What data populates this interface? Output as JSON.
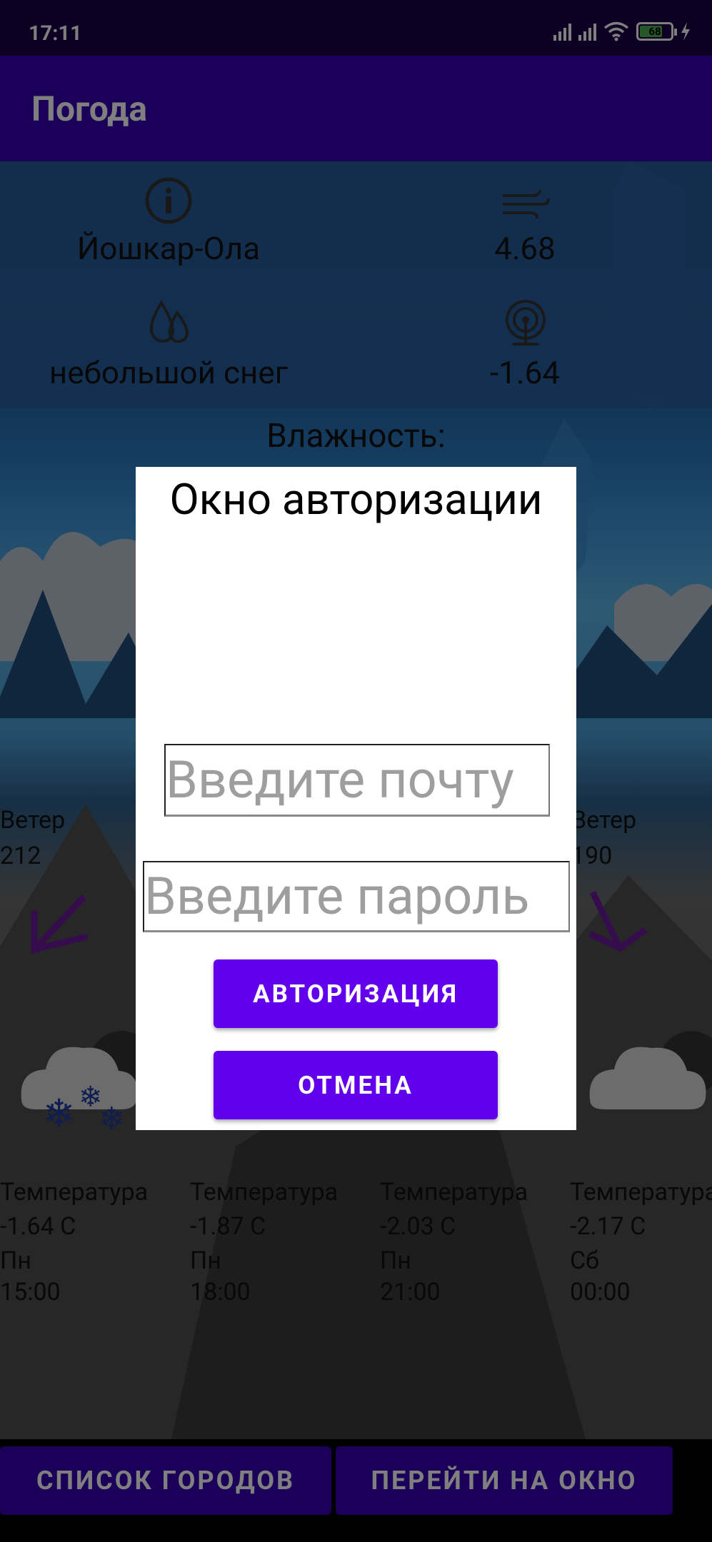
{
  "status_bar": {
    "time": "17:11",
    "battery_level": "68"
  },
  "app_bar": {
    "title": "Погода"
  },
  "current": {
    "city": "Йошкар-Ола",
    "wind_speed": "4.68",
    "description": "небольшой снег",
    "temperature": "-1.64"
  },
  "humidity_label": "Влажность:",
  "forecast": {
    "wind_label": "Ветер",
    "wind_left": "212",
    "wind_right": "190",
    "temp_label": "Температура",
    "items": [
      {
        "temp": "-1.64 C",
        "day": "Пн",
        "time": "15:00"
      },
      {
        "temp": "-1.87 C",
        "day": "Пн",
        "time": "18:00"
      },
      {
        "temp": "-2.03 C",
        "day": "Пн",
        "time": "21:00"
      },
      {
        "temp": "-2.17 C",
        "day": "Сб",
        "time": "00:00"
      }
    ]
  },
  "bottom_bar": {
    "cities_button": "СПИСОК ГОРОДОВ",
    "window_button": "ПЕРЕЙТИ НА ОКНО"
  },
  "auth_dialog": {
    "title": "Окно авторизации",
    "email_placeholder": "Введите почту",
    "password_placeholder": "Введите пароль",
    "login_button": "АВТОРИЗАЦИЯ",
    "cancel_button": "ОТМЕНА"
  },
  "colors": {
    "app_bar": "#3700b3",
    "status_bar": "#1a0047",
    "dialog_button": "#6200ee",
    "arrow": "#6a1b9a"
  }
}
